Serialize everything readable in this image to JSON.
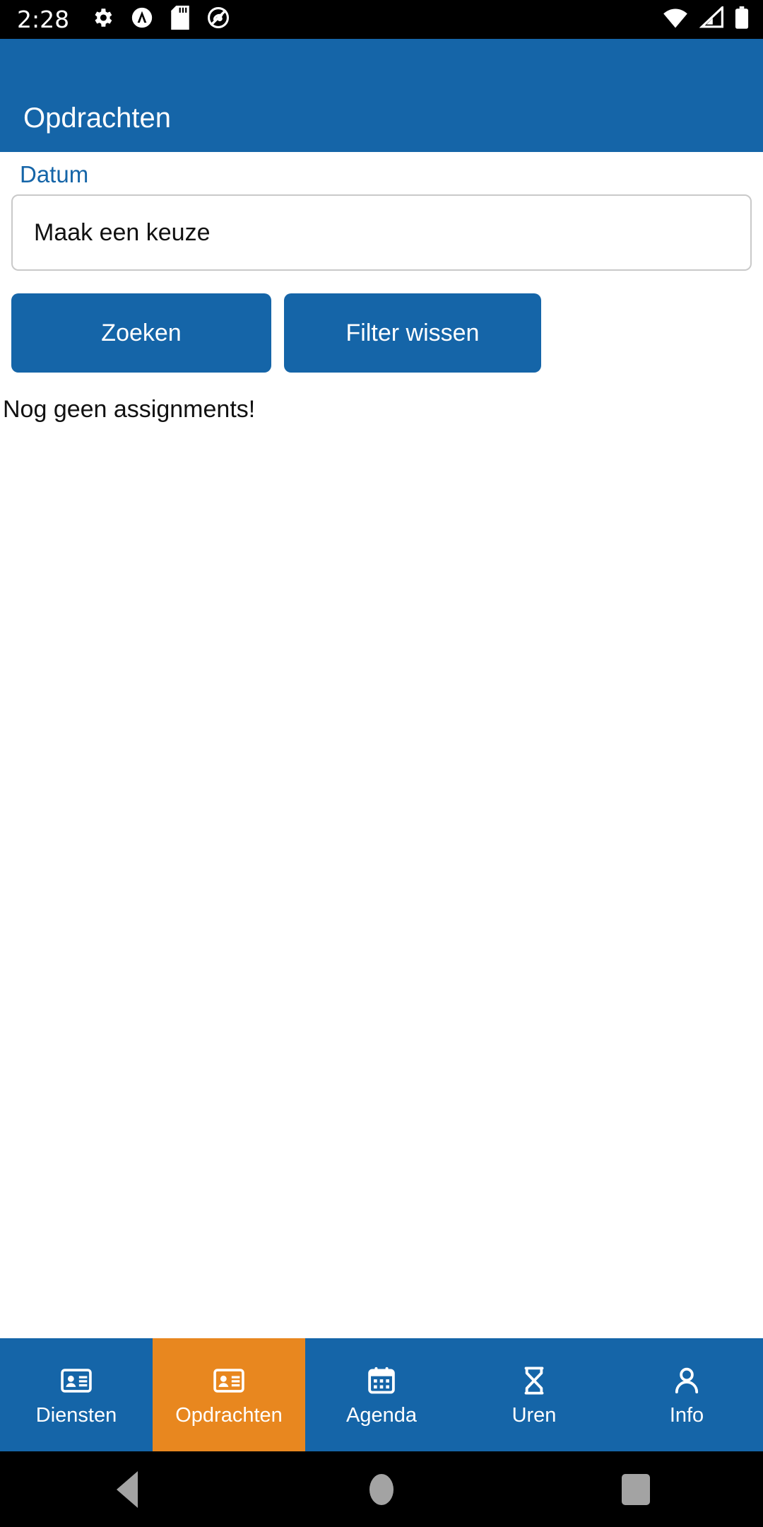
{
  "status_bar": {
    "time": "2:28",
    "left_icons": [
      "gear-icon",
      "circle-a-icon",
      "sd-card-icon",
      "do-not-disturb-icon"
    ],
    "right_icons": [
      "wifi-icon",
      "cellular-signal-icon",
      "battery-icon"
    ],
    "background_color": "#000000",
    "foreground_color": "#ffffff"
  },
  "app_bar": {
    "title": "Opdrachten",
    "background_color": "#1565a8",
    "text_color": "#ffffff"
  },
  "form": {
    "date_label": "Datum",
    "date_select": {
      "value": "Maak een keuze",
      "placeholder": "Maak een keuze"
    },
    "search_button": "Zoeken",
    "clear_filter_button": "Filter wissen",
    "button_color": "#1565a8"
  },
  "list": {
    "empty_message": "Nog geen assignments!"
  },
  "tab_bar": {
    "active_color": "#e8871f",
    "inactive_color": "#1565a8",
    "items": [
      {
        "label": "Diensten",
        "icon": "id-card-icon",
        "active": false
      },
      {
        "label": "Opdrachten",
        "icon": "id-card-icon",
        "active": true
      },
      {
        "label": "Agenda",
        "icon": "calendar-icon",
        "active": false
      },
      {
        "label": "Uren",
        "icon": "hourglass-icon",
        "active": false
      },
      {
        "label": "Info",
        "icon": "person-icon",
        "active": false
      }
    ]
  },
  "system_nav": {
    "back": "back-button",
    "home": "home-button",
    "recents": "recents-button",
    "background_color": "#000000",
    "icon_color": "#a3a3a3"
  }
}
